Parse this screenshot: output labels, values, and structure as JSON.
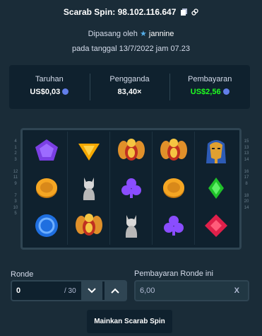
{
  "header": {
    "title": "Scarab Spin: 98.102.116.647"
  },
  "placed_by": {
    "prefix": "Dipasang oleh",
    "user": "jannine"
  },
  "date": "pada tanggal 13/7/2022 jam 07.23",
  "stats": {
    "bet": {
      "label": "Taruhan",
      "value": "US$0,03"
    },
    "multiplier": {
      "label": "Pengganda",
      "value": "83,40×"
    },
    "payout": {
      "label": "Pembayaran",
      "value": "US$2,56"
    }
  },
  "reels": [
    [
      "purple-gem",
      "gold-coin",
      "blue-ring"
    ],
    [
      "yellow-triangle-gem",
      "silver-cat",
      "scarab"
    ],
    [
      "scarab",
      "purple-clover",
      "silver-cat"
    ],
    [
      "scarab",
      "gold-coin",
      "purple-clover"
    ],
    [
      "pharaoh-mask",
      "green-diamond",
      "red-gem"
    ]
  ],
  "paylines": {
    "left": [
      "4",
      "1",
      "2",
      "3",
      "",
      "12",
      "11",
      "9",
      "",
      "7",
      "3",
      "10",
      "5"
    ],
    "right": [
      "15",
      "13",
      "13",
      "14",
      "",
      "16",
      "17",
      "8",
      "",
      "18",
      "20",
      "14",
      ""
    ]
  },
  "controls": {
    "rounds_label": "Ronde",
    "rounds_value": "0",
    "rounds_total": "/ 30",
    "payout_label": "Pembayaran Ronde ini",
    "payout_value": "6,00",
    "payout_clear": "X",
    "play_label": "Mainkan Scarab Spin"
  },
  "colors": {
    "bg": "#1a2c38",
    "panel": "#0f212e",
    "border": "#2f4553",
    "green": "#1fff20"
  }
}
